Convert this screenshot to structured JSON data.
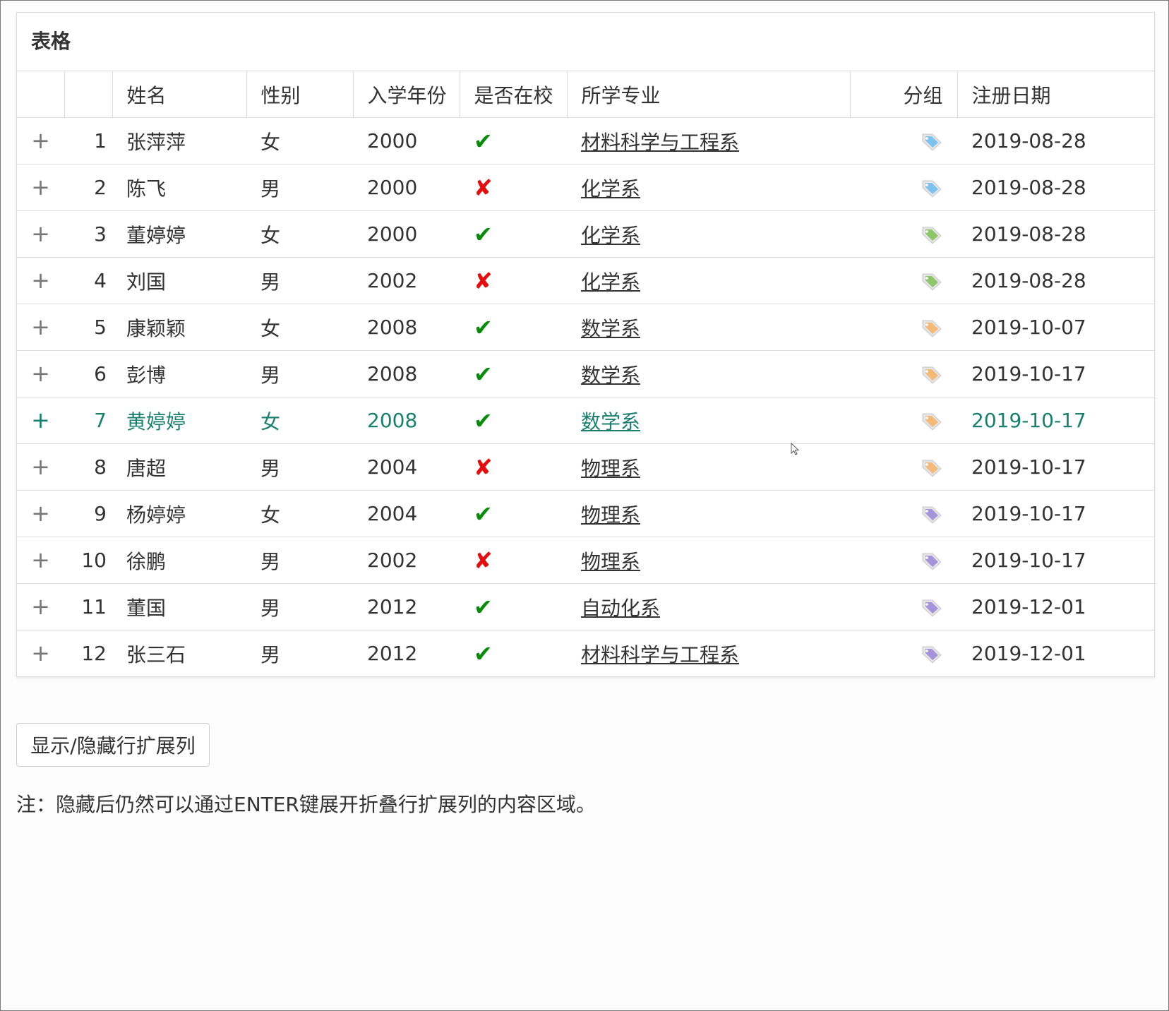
{
  "panel": {
    "title": "表格"
  },
  "table": {
    "headers": {
      "expand": "",
      "index": "",
      "name": "姓名",
      "gender": "性别",
      "year": "入学年份",
      "in_school": "是否在校",
      "major": "所学专业",
      "group": "分组",
      "reg_date": "注册日期"
    },
    "rows": [
      {
        "index": "1",
        "name": "张萍萍",
        "gender": "女",
        "year": "2000",
        "in_school": "✔",
        "major": "材料科学与工程系",
        "group_color": "#7ec3ef",
        "reg_date": "2019-08-28"
      },
      {
        "index": "2",
        "name": "陈飞",
        "gender": "男",
        "year": "2000",
        "in_school": "✘",
        "major": "化学系",
        "group_color": "#7ec3ef",
        "reg_date": "2019-08-28"
      },
      {
        "index": "3",
        "name": "董婷婷",
        "gender": "女",
        "year": "2000",
        "in_school": "✔",
        "major": "化学系",
        "group_color": "#8cc76a",
        "reg_date": "2019-08-28"
      },
      {
        "index": "4",
        "name": "刘国",
        "gender": "男",
        "year": "2002",
        "in_school": "✘",
        "major": "化学系",
        "group_color": "#8cc76a",
        "reg_date": "2019-08-28"
      },
      {
        "index": "5",
        "name": "康颖颖",
        "gender": "女",
        "year": "2008",
        "in_school": "✔",
        "major": "数学系",
        "group_color": "#f5b97a",
        "reg_date": "2019-10-07"
      },
      {
        "index": "6",
        "name": "彭博",
        "gender": "男",
        "year": "2008",
        "in_school": "✔",
        "major": "数学系",
        "group_color": "#f5b97a",
        "reg_date": "2019-10-17"
      },
      {
        "index": "7",
        "name": "黄婷婷",
        "gender": "女",
        "year": "2008",
        "in_school": "✔",
        "major": "数学系",
        "group_color": "#f5b97a",
        "reg_date": "2019-10-17"
      },
      {
        "index": "8",
        "name": "唐超",
        "gender": "男",
        "year": "2004",
        "in_school": "✘",
        "major": "物理系",
        "group_color": "#f5b97a",
        "reg_date": "2019-10-17"
      },
      {
        "index": "9",
        "name": "杨婷婷",
        "gender": "女",
        "year": "2004",
        "in_school": "✔",
        "major": "物理系",
        "group_color": "#a594dc",
        "reg_date": "2019-10-17"
      },
      {
        "index": "10",
        "name": "徐鹏",
        "gender": "男",
        "year": "2002",
        "in_school": "✘",
        "major": "物理系",
        "group_color": "#a594dc",
        "reg_date": "2019-10-17"
      },
      {
        "index": "11",
        "name": "董国",
        "gender": "男",
        "year": "2012",
        "in_school": "✔",
        "major": "自动化系",
        "group_color": "#a594dc",
        "reg_date": "2019-12-01"
      },
      {
        "index": "12",
        "name": "张三石",
        "gender": "男",
        "year": "2012",
        "in_school": "✔",
        "major": "材料科学与工程系",
        "group_color": "#a594dc",
        "reg_date": "2019-12-01"
      }
    ],
    "active_row": "7",
    "expand_symbol": "+"
  },
  "toggle_button": {
    "label": "显示/隐藏行扩展列"
  },
  "note": {
    "text": "注：隐藏后仍然可以通过ENTER键展开折叠行扩展列的内容区域。"
  },
  "colors": {
    "check": "#0a8a0a",
    "cross": "#e01010",
    "active_row_text": "#1a7f6f",
    "border": "#dcdcdc"
  }
}
